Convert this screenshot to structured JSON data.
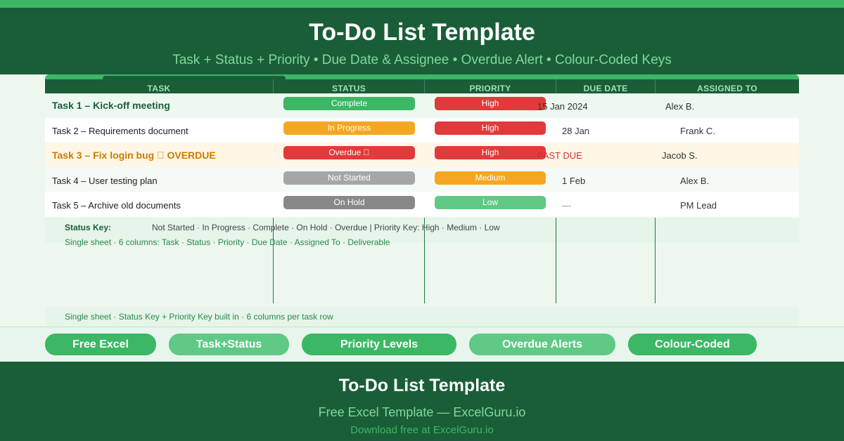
{
  "header": {
    "title": "To-Do List Template",
    "subtitle": "Task + Status + Priority • Due Date & Assignee • Overdue Alert • Colour-Coded Keys"
  },
  "table": {
    "columns": [
      "TASK",
      "STATUS",
      "PRIORITY",
      "DUE DATE",
      "ASSIGNED TO"
    ],
    "rows": [
      {
        "task": "Task 1 – Kick-off meeting",
        "status": "Complete",
        "priority": "High",
        "due": "15 Jan 2024",
        "assignee": "Alex B."
      },
      {
        "task": "Task 2 – Requirements document",
        "status": "In Progress",
        "priority": "High",
        "due": "28 Jan",
        "assignee": "Frank C."
      },
      {
        "task": "Task 3 – Fix login bug ⃞ OVERDUE",
        "status": "Overdue ⃞",
        "priority": "High",
        "due": "PAST DUE",
        "assignee": "Jacob S."
      },
      {
        "task": "Task 4 – User testing plan",
        "status": "Not Started",
        "priority": "Medium",
        "due": "1 Feb",
        "assignee": "Alex B."
      },
      {
        "task": "Task 5 – Archive old documents",
        "status": "On Hold",
        "priority": "Low",
        "due": "—",
        "assignee": "PM Lead"
      }
    ]
  },
  "status_key": {
    "label": "Status Key:",
    "text": "Not Started · In Progress · Complete · On Hold · Overdue | Priority Key: High · Medium · Low",
    "note": "Single sheet · 6 columns: Task · Status · Priority · Due Date · Assigned To · Deliverable"
  },
  "info_bar": {
    "text": "Single sheet · Status Key + Priority Key built in · 6 columns per task row"
  },
  "features": [
    "Free Excel",
    "Task+Status",
    "Priority Levels",
    "Overdue Alerts",
    "Colour-Coded"
  ],
  "footer": {
    "title": "To-Do List Template",
    "subtitle": "Free Excel Template — ExcelGuru.io",
    "download": "Download free at ExcelGuru.io"
  },
  "colors": {
    "dark_green": "#1a5e38",
    "accent_green": "#3cb765",
    "light_green": "#5fc985",
    "complete": "#3cb765",
    "in_progress": "#f5a623",
    "overdue": "#e03a3a",
    "not_started": "#a6a6a6",
    "on_hold": "#888888",
    "priority_high": "#e03a3a",
    "priority_medium": "#f5a623",
    "priority_low": "#5fc985"
  }
}
